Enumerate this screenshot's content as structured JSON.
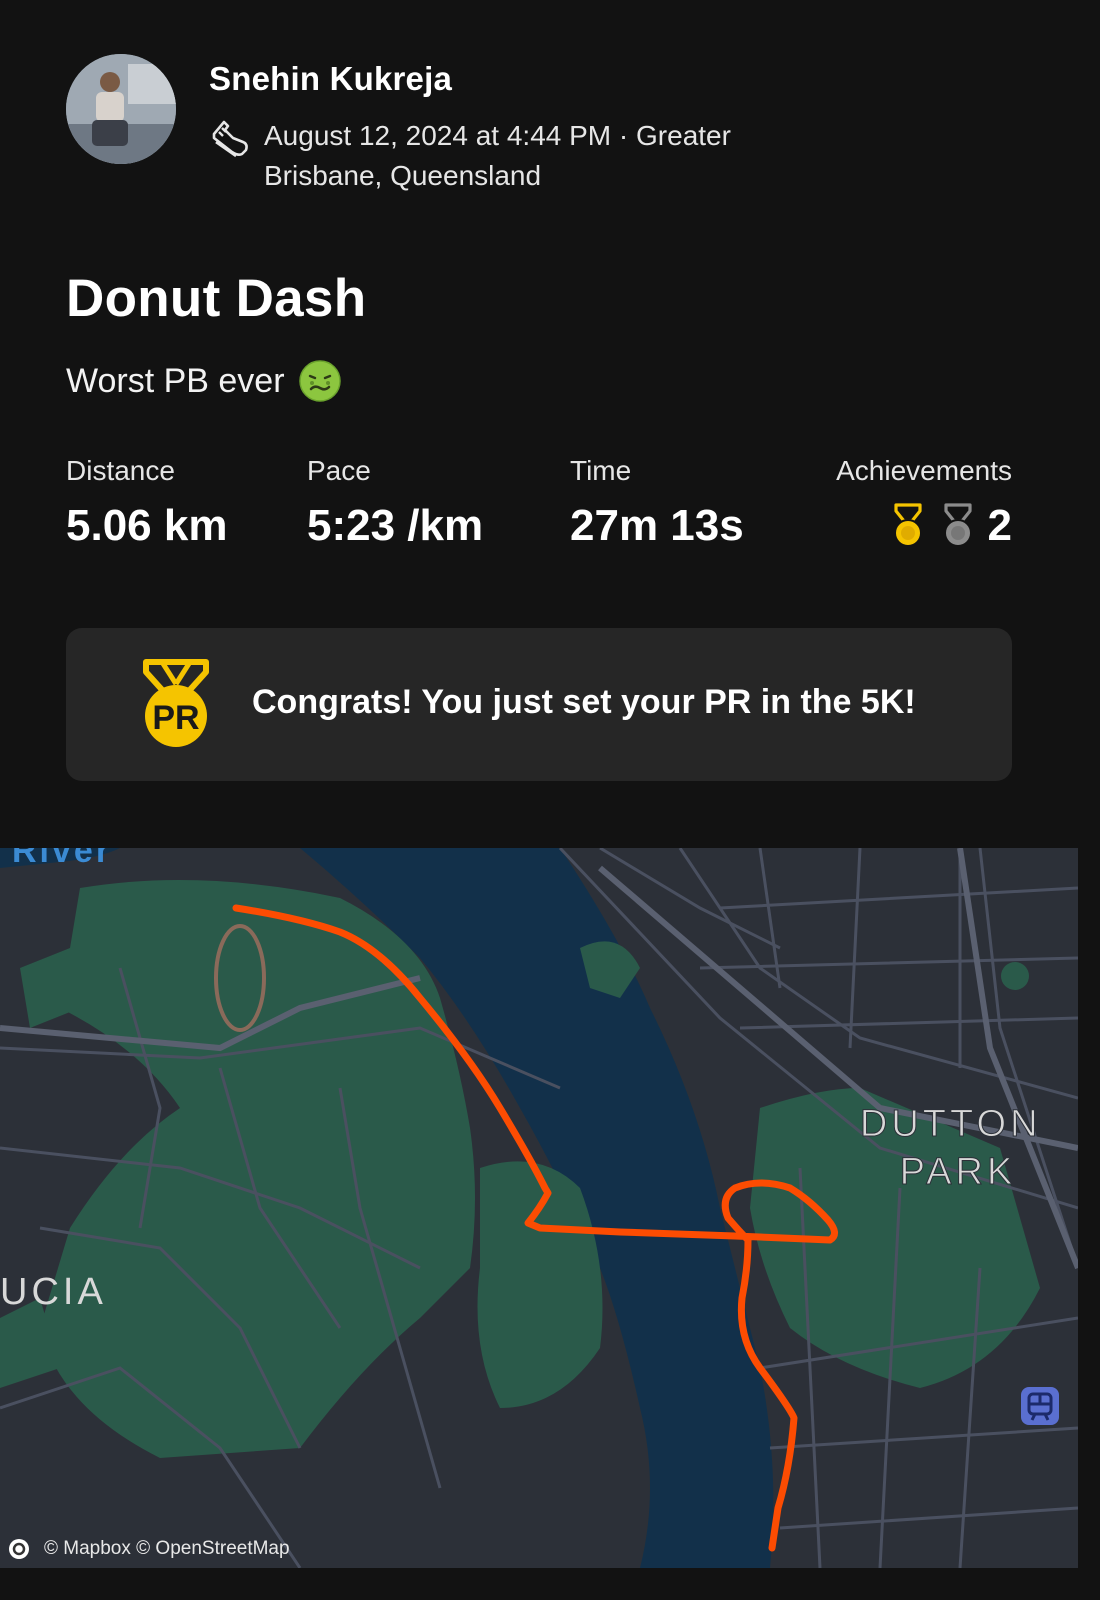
{
  "user": {
    "name": "Snehin Kukreja",
    "date_location": "August 12, 2024 at 4:44 PM · Greater Brisbane, Queensland"
  },
  "activity": {
    "title": "Donut Dash",
    "description": "Worst PB ever",
    "description_emoji": "nauseated-face-emoji"
  },
  "stats": {
    "distance": {
      "label": "Distance",
      "value": "5.06 km"
    },
    "pace": {
      "label": "Pace",
      "value": "5:23 /km"
    },
    "time": {
      "label": "Time",
      "value": "27m 13s"
    },
    "achievements": {
      "label": "Achievements",
      "count": "2",
      "medals": [
        "gold-medal-icon",
        "silver-medal-icon"
      ]
    }
  },
  "pr_banner": {
    "icon": "pr-medal-icon",
    "icon_text": "PR",
    "text": "Congrats! You just set your PR in the 5K!"
  },
  "map": {
    "labels": {
      "top": "River",
      "east": "DUTTON PARK",
      "west": "UCIA"
    },
    "attribution": "© Mapbox © OpenStreetMap",
    "route_color": "#fc4c02"
  },
  "colors": {
    "background": "#121212",
    "card": "#262626",
    "gold": "#f5c400",
    "silver": "#8c8c8c",
    "water": "#12304a",
    "park": "#2a5a4a",
    "land": "#2c3038"
  }
}
